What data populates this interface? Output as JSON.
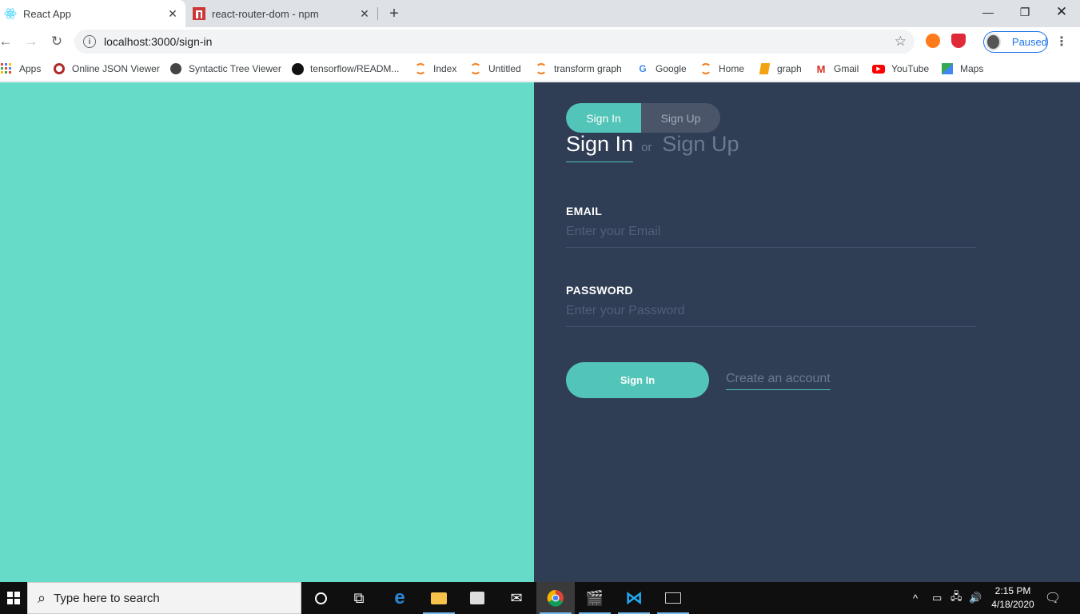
{
  "browser": {
    "tabs": [
      {
        "title": "React App",
        "icon": "react-icon",
        "active": true
      },
      {
        "title": "react-router-dom - npm",
        "icon": "npm-icon",
        "active": false
      }
    ],
    "url": "localhost:3000/sign-in",
    "profile_label": "Paused",
    "bookmarks": [
      {
        "label": "Apps",
        "icon": "apps-grid-icon"
      },
      {
        "label": "Online JSON Viewer",
        "icon": "json-viewer-icon"
      },
      {
        "label": "Syntactic Tree Viewer",
        "icon": "globe-icon"
      },
      {
        "label": "tensorflow/READM...",
        "icon": "github-icon"
      },
      {
        "label": "Index",
        "icon": "jupyter-icon"
      },
      {
        "label": "Untitled",
        "icon": "jupyter-icon"
      },
      {
        "label": "transform graph",
        "icon": "jupyter-icon"
      },
      {
        "label": "Google",
        "icon": "google-icon"
      },
      {
        "label": "Home",
        "icon": "jupyter-icon"
      },
      {
        "label": "graph",
        "icon": "notebook-icon"
      },
      {
        "label": "Gmail",
        "icon": "gmail-icon"
      },
      {
        "label": "YouTube",
        "icon": "youtube-icon"
      },
      {
        "label": "Maps",
        "icon": "maps-icon"
      }
    ]
  },
  "auth": {
    "switcher": {
      "sign_in": "Sign In",
      "sign_up": "Sign Up"
    },
    "heading": {
      "active": "Sign In",
      "or": "or",
      "inactive": "Sign Up"
    },
    "email": {
      "label": "EMAIL",
      "placeholder": "Enter your Email",
      "value": ""
    },
    "password": {
      "label": "PASSWORD",
      "placeholder": "Enter your Password",
      "value": ""
    },
    "submit_label": "Sign In",
    "create_account_label": "Create an account"
  },
  "colors": {
    "left_panel": "#66dbc8",
    "right_panel": "#2f3d55",
    "accent": "#52c4b8"
  },
  "taskbar": {
    "search_placeholder": "Type here to search",
    "time": "2:15 PM",
    "date": "4/18/2020"
  }
}
